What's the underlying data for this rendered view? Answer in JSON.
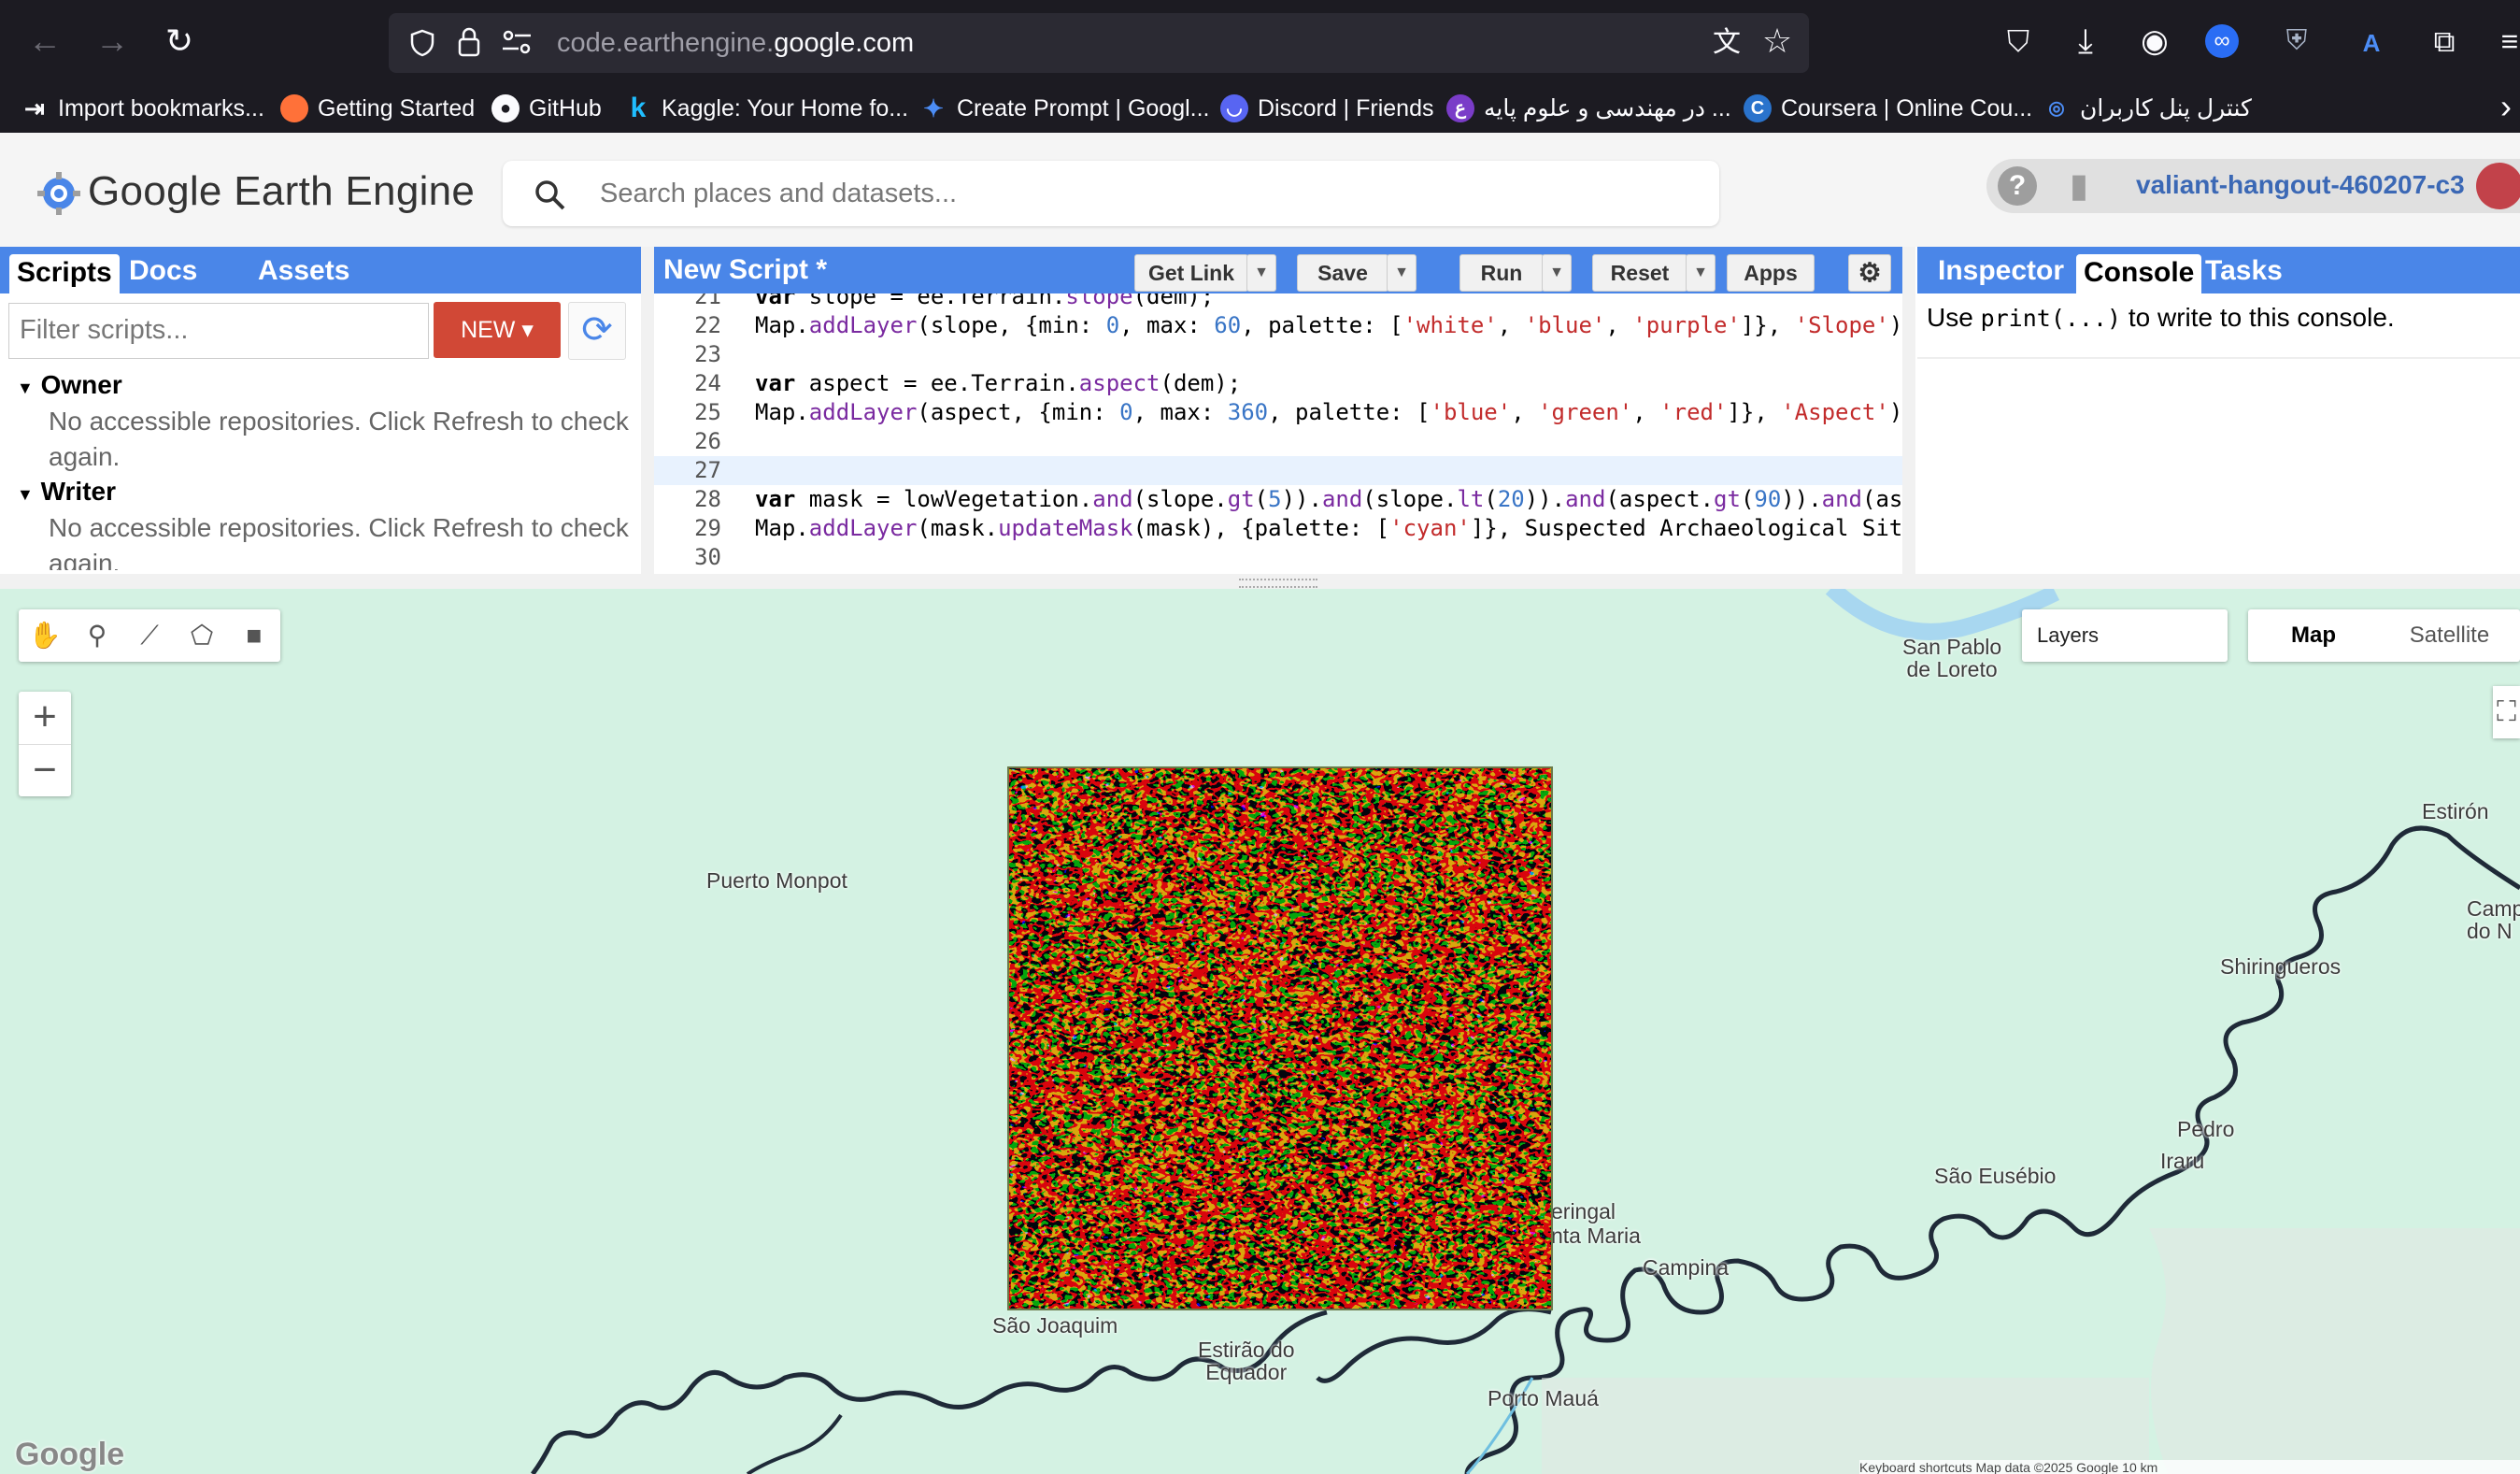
{
  "browser": {
    "url_prefix": "code.earthengine.",
    "url_domain": "google.com",
    "bookmarks": [
      {
        "label": "Import bookmarks...",
        "icon": "import-icon"
      },
      {
        "label": "Getting Started",
        "icon": "firefox-icon"
      },
      {
        "label": "GitHub",
        "icon": "github-icon"
      },
      {
        "label": "Kaggle: Your Home fo...",
        "icon": "kaggle-icon"
      },
      {
        "label": "Create Prompt | Googl...",
        "icon": "google-ai-icon"
      },
      {
        "label": "Discord | Friends",
        "icon": "discord-icon"
      },
      {
        "label": "در مهندسی و علوم پایه ...",
        "icon": "site-icon"
      },
      {
        "label": "Coursera | Online Cou...",
        "icon": "coursera-icon"
      },
      {
        "label": "کنترل پنل کاربران",
        "icon": "panel-icon"
      }
    ]
  },
  "gee": {
    "logo_text": "Google Earth Engine",
    "search_placeholder": "Search places and datasets...",
    "account": "valiant-hangout-460207-c3"
  },
  "left_panel": {
    "tabs": [
      "Scripts",
      "Docs",
      "Assets"
    ],
    "filter_placeholder": "Filter scripts...",
    "new_button": "NEW",
    "sections": [
      {
        "title": "Owner",
        "message": "No accessible repositories. Click Refresh to check again."
      },
      {
        "title": "Writer",
        "message": "No accessible repositories. Click Refresh to check again."
      }
    ]
  },
  "editor": {
    "title": "New Script *",
    "buttons": {
      "get_link": "Get Link",
      "save": "Save",
      "run": "Run",
      "reset": "Reset",
      "apps": "Apps"
    },
    "current_line": 27,
    "lines": [
      {
        "n": "21",
        "text": "var slope = ee.Terrain.slope(dem);"
      },
      {
        "n": "22",
        "text": "Map.addLayer(slope, {min: 0, max: 60, palette: ['white', 'blue', 'purple']}, 'Slope');"
      },
      {
        "n": "23",
        "text": ""
      },
      {
        "n": "24",
        "text": "var aspect = ee.Terrain.aspect(dem);"
      },
      {
        "n": "25",
        "text": "Map.addLayer(aspect, {min: 0, max: 360, palette: ['blue', 'green', 'red']}, 'Aspect');"
      },
      {
        "n": "26",
        "text": ""
      },
      {
        "n": "27",
        "text": ""
      },
      {
        "n": "28",
        "text": "var mask = lowVegetation.and(slope.gt(5)).and(slope.lt(20)).and(aspect.gt(90)).and(asp"
      },
      {
        "n": "29",
        "text": "Map.addLayer(mask.updateMask(mask), {palette: ['cyan']}, 'Suspected Archaeological Sit"
      },
      {
        "n": "30",
        "text": ""
      }
    ]
  },
  "right_panel": {
    "tabs": [
      "Inspector",
      "Console",
      "Tasks"
    ],
    "console_prefix": "Use ",
    "console_code": "print(...)",
    "console_suffix": " to write to this console."
  },
  "map": {
    "layers_label": "Layers",
    "map_type": [
      "Map",
      "Satellite"
    ],
    "labels": {
      "puerto_monpot": "Puerto Monpot",
      "san_pablo_1": "San Pablo",
      "san_pablo_2": "de Loreto",
      "estiron": "Estirón",
      "camp_1": "Camp",
      "camp_2": "do N",
      "shiringueros": "Shiringueros",
      "pedro": "Pedro",
      "iraru": "Iraru",
      "sao_eusebio": "São Eusébio",
      "seringal": "eringal",
      "santa_maria": "nta Maria",
      "campina": "Campina",
      "sao_joaquim": "São Joaquim",
      "estirao_1": "Estirão do",
      "estirao_2": "Equador",
      "porto_maua": "Porto Mauá"
    },
    "google_logo": "Google",
    "attribution": "Keyboard shortcuts   Map data ©2025 Google   10 km"
  },
  "colors": {
    "accent": "#4a86e8",
    "new_button": "#d14836",
    "map_land": "#d4f2e3",
    "river": "#1f2a38"
  }
}
